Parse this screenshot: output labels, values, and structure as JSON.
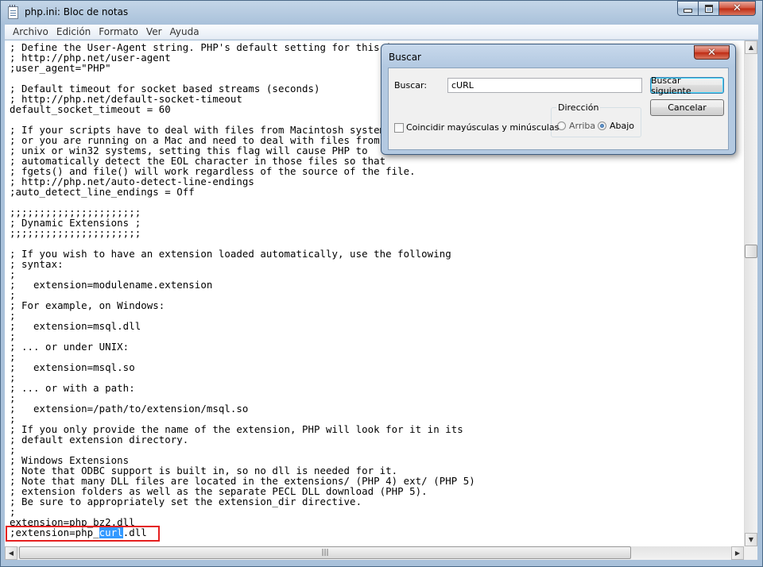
{
  "window": {
    "title": "php.ini: Bloc de notas",
    "minimize_icon": "minimize-icon",
    "maximize_icon": "maximize-icon",
    "close_icon": "close-icon"
  },
  "menu": {
    "items": [
      {
        "label": "Archivo"
      },
      {
        "label": "Edición"
      },
      {
        "label": "Formato"
      },
      {
        "label": "Ver"
      },
      {
        "label": "Ayuda"
      }
    ]
  },
  "editor": {
    "lines": [
      "; Define the User-Agent string. PHP's default setting for this is empty.",
      "; http://php.net/user-agent",
      ";user_agent=\"PHP\"",
      "",
      "; Default timeout for socket based streams (seconds)",
      "; http://php.net/default-socket-timeout",
      "default_socket_timeout = 60",
      "",
      "; If your scripts have to deal with files from Macintosh systems,",
      "; or you are running on a Mac and need to deal with files from",
      "; unix or win32 systems, setting this flag will cause PHP to",
      "; automatically detect the EOL character in those files so that",
      "; fgets() and file() will work regardless of the source of the file.",
      "; http://php.net/auto-detect-line-endings",
      ";auto_detect_line_endings = Off",
      "",
      ";;;;;;;;;;;;;;;;;;;;;;",
      "; Dynamic Extensions ;",
      ";;;;;;;;;;;;;;;;;;;;;;",
      "",
      "; If you wish to have an extension loaded automatically, use the following",
      "; syntax:",
      ";",
      ";   extension=modulename.extension",
      ";",
      "; For example, on Windows:",
      ";",
      ";   extension=msql.dll",
      ";",
      "; ... or under UNIX:",
      ";",
      ";   extension=msql.so",
      ";",
      "; ... or with a path:",
      ";",
      ";   extension=/path/to/extension/msql.so",
      ";",
      "; If you only provide the name of the extension, PHP will look for it in its",
      "; default extension directory.",
      ";",
      "; Windows Extensions",
      "; Note that ODBC support is built in, so no dll is needed for it.",
      "; Note that many DLL files are located in the extensions/ (PHP 4) ext/ (PHP 5)",
      "; extension folders as well as the separate PECL DLL download (PHP 5).",
      "; Be sure to appropriately set the extension_dir directive.",
      ";",
      "extension=php_bz2.dll"
    ],
    "last_line_before": ";extension=php_",
    "last_line_selected": "curl",
    "last_line_after": ".dll"
  },
  "find_dialog": {
    "title": "Buscar",
    "find_label": "Buscar:",
    "find_value": "cURL",
    "find_next_label": "Buscar siguiente",
    "cancel_label": "Cancelar",
    "direction_label": "Dirección",
    "up_label": "Arriba",
    "down_label": "Abajo",
    "direction_selected": "down",
    "match_case_label": "Coincidir mayúsculas y minúsculas",
    "match_case_checked": false
  }
}
